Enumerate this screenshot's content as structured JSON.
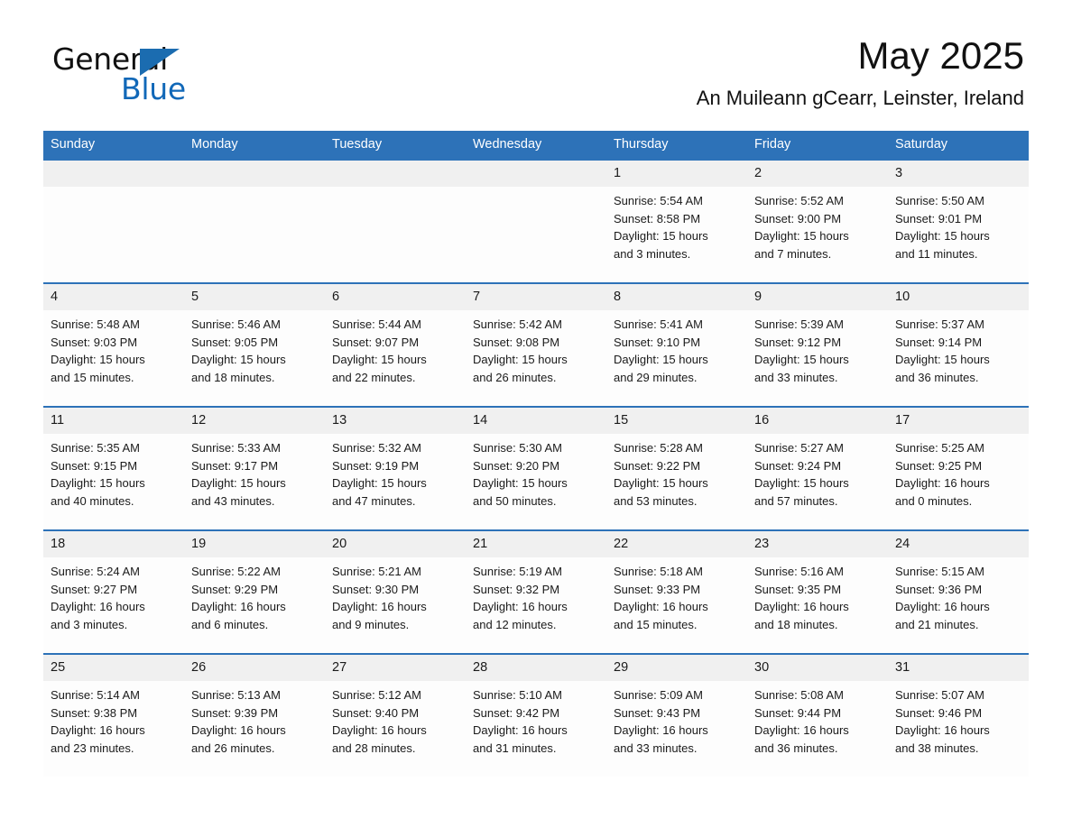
{
  "brand": {
    "name_part1": "General",
    "name_part2": "Blue",
    "logo_icon": "triangle-logo-icon",
    "accent_color": "#1168b8"
  },
  "header": {
    "month_title": "May 2025",
    "location": "An Muileann gCearr, Leinster, Ireland"
  },
  "calendar": {
    "header_bg": "#2d72b8",
    "daynum_bg": "#f0f0f0",
    "weekday_headers": [
      "Sunday",
      "Monday",
      "Tuesday",
      "Wednesday",
      "Thursday",
      "Friday",
      "Saturday"
    ],
    "weeks": [
      [
        {
          "day": "",
          "lines": []
        },
        {
          "day": "",
          "lines": []
        },
        {
          "day": "",
          "lines": []
        },
        {
          "day": "",
          "lines": []
        },
        {
          "day": "1",
          "lines": [
            "Sunrise: 5:54 AM",
            "Sunset: 8:58 PM",
            "Daylight: 15 hours",
            "and 3 minutes."
          ]
        },
        {
          "day": "2",
          "lines": [
            "Sunrise: 5:52 AM",
            "Sunset: 9:00 PM",
            "Daylight: 15 hours",
            "and 7 minutes."
          ]
        },
        {
          "day": "3",
          "lines": [
            "Sunrise: 5:50 AM",
            "Sunset: 9:01 PM",
            "Daylight: 15 hours",
            "and 11 minutes."
          ]
        }
      ],
      [
        {
          "day": "4",
          "lines": [
            "Sunrise: 5:48 AM",
            "Sunset: 9:03 PM",
            "Daylight: 15 hours",
            "and 15 minutes."
          ]
        },
        {
          "day": "5",
          "lines": [
            "Sunrise: 5:46 AM",
            "Sunset: 9:05 PM",
            "Daylight: 15 hours",
            "and 18 minutes."
          ]
        },
        {
          "day": "6",
          "lines": [
            "Sunrise: 5:44 AM",
            "Sunset: 9:07 PM",
            "Daylight: 15 hours",
            "and 22 minutes."
          ]
        },
        {
          "day": "7",
          "lines": [
            "Sunrise: 5:42 AM",
            "Sunset: 9:08 PM",
            "Daylight: 15 hours",
            "and 26 minutes."
          ]
        },
        {
          "day": "8",
          "lines": [
            "Sunrise: 5:41 AM",
            "Sunset: 9:10 PM",
            "Daylight: 15 hours",
            "and 29 minutes."
          ]
        },
        {
          "day": "9",
          "lines": [
            "Sunrise: 5:39 AM",
            "Sunset: 9:12 PM",
            "Daylight: 15 hours",
            "and 33 minutes."
          ]
        },
        {
          "day": "10",
          "lines": [
            "Sunrise: 5:37 AM",
            "Sunset: 9:14 PM",
            "Daylight: 15 hours",
            "and 36 minutes."
          ]
        }
      ],
      [
        {
          "day": "11",
          "lines": [
            "Sunrise: 5:35 AM",
            "Sunset: 9:15 PM",
            "Daylight: 15 hours",
            "and 40 minutes."
          ]
        },
        {
          "day": "12",
          "lines": [
            "Sunrise: 5:33 AM",
            "Sunset: 9:17 PM",
            "Daylight: 15 hours",
            "and 43 minutes."
          ]
        },
        {
          "day": "13",
          "lines": [
            "Sunrise: 5:32 AM",
            "Sunset: 9:19 PM",
            "Daylight: 15 hours",
            "and 47 minutes."
          ]
        },
        {
          "day": "14",
          "lines": [
            "Sunrise: 5:30 AM",
            "Sunset: 9:20 PM",
            "Daylight: 15 hours",
            "and 50 minutes."
          ]
        },
        {
          "day": "15",
          "lines": [
            "Sunrise: 5:28 AM",
            "Sunset: 9:22 PM",
            "Daylight: 15 hours",
            "and 53 minutes."
          ]
        },
        {
          "day": "16",
          "lines": [
            "Sunrise: 5:27 AM",
            "Sunset: 9:24 PM",
            "Daylight: 15 hours",
            "and 57 minutes."
          ]
        },
        {
          "day": "17",
          "lines": [
            "Sunrise: 5:25 AM",
            "Sunset: 9:25 PM",
            "Daylight: 16 hours",
            "and 0 minutes."
          ]
        }
      ],
      [
        {
          "day": "18",
          "lines": [
            "Sunrise: 5:24 AM",
            "Sunset: 9:27 PM",
            "Daylight: 16 hours",
            "and 3 minutes."
          ]
        },
        {
          "day": "19",
          "lines": [
            "Sunrise: 5:22 AM",
            "Sunset: 9:29 PM",
            "Daylight: 16 hours",
            "and 6 minutes."
          ]
        },
        {
          "day": "20",
          "lines": [
            "Sunrise: 5:21 AM",
            "Sunset: 9:30 PM",
            "Daylight: 16 hours",
            "and 9 minutes."
          ]
        },
        {
          "day": "21",
          "lines": [
            "Sunrise: 5:19 AM",
            "Sunset: 9:32 PM",
            "Daylight: 16 hours",
            "and 12 minutes."
          ]
        },
        {
          "day": "22",
          "lines": [
            "Sunrise: 5:18 AM",
            "Sunset: 9:33 PM",
            "Daylight: 16 hours",
            "and 15 minutes."
          ]
        },
        {
          "day": "23",
          "lines": [
            "Sunrise: 5:16 AM",
            "Sunset: 9:35 PM",
            "Daylight: 16 hours",
            "and 18 minutes."
          ]
        },
        {
          "day": "24",
          "lines": [
            "Sunrise: 5:15 AM",
            "Sunset: 9:36 PM",
            "Daylight: 16 hours",
            "and 21 minutes."
          ]
        }
      ],
      [
        {
          "day": "25",
          "lines": [
            "Sunrise: 5:14 AM",
            "Sunset: 9:38 PM",
            "Daylight: 16 hours",
            "and 23 minutes."
          ]
        },
        {
          "day": "26",
          "lines": [
            "Sunrise: 5:13 AM",
            "Sunset: 9:39 PM",
            "Daylight: 16 hours",
            "and 26 minutes."
          ]
        },
        {
          "day": "27",
          "lines": [
            "Sunrise: 5:12 AM",
            "Sunset: 9:40 PM",
            "Daylight: 16 hours",
            "and 28 minutes."
          ]
        },
        {
          "day": "28",
          "lines": [
            "Sunrise: 5:10 AM",
            "Sunset: 9:42 PM",
            "Daylight: 16 hours",
            "and 31 minutes."
          ]
        },
        {
          "day": "29",
          "lines": [
            "Sunrise: 5:09 AM",
            "Sunset: 9:43 PM",
            "Daylight: 16 hours",
            "and 33 minutes."
          ]
        },
        {
          "day": "30",
          "lines": [
            "Sunrise: 5:08 AM",
            "Sunset: 9:44 PM",
            "Daylight: 16 hours",
            "and 36 minutes."
          ]
        },
        {
          "day": "31",
          "lines": [
            "Sunrise: 5:07 AM",
            "Sunset: 9:46 PM",
            "Daylight: 16 hours",
            "and 38 minutes."
          ]
        }
      ]
    ]
  }
}
